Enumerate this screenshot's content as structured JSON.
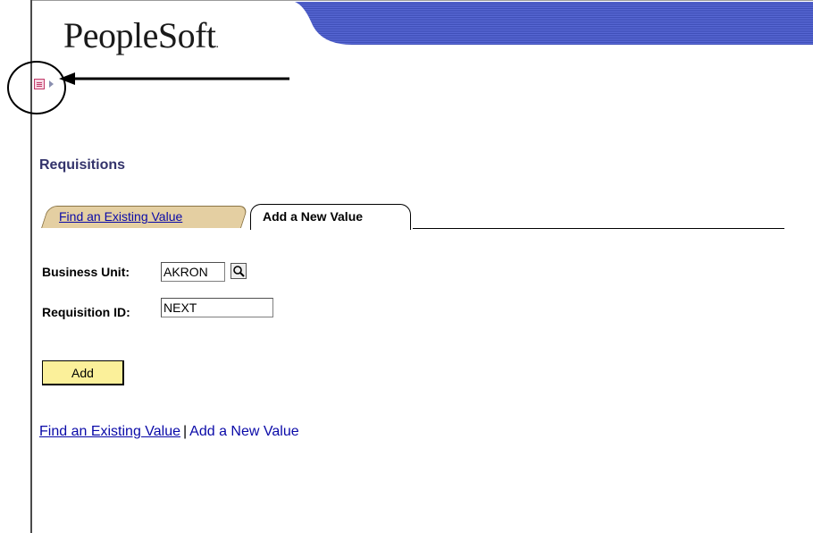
{
  "header": {
    "logo_text": "PeopleSoft",
    "logo_mark": "."
  },
  "page": {
    "title": "Requisitions"
  },
  "tabs": [
    {
      "label": "Find an Existing Value",
      "active": false
    },
    {
      "label": "Add a New Value",
      "active": true
    }
  ],
  "form": {
    "business_unit": {
      "label": "Business Unit:",
      "value": "AKRON"
    },
    "requisition_id": {
      "label": "Requisition ID:",
      "value": "NEXT"
    },
    "add_label": "Add"
  },
  "bottom_links": {
    "find_label": "Find an Existing Value",
    "separator": "|",
    "add_label": "Add a New Value"
  },
  "icons": {
    "menu": "menu-icon",
    "lookup": "search-icon",
    "pointer": "annotation-arrow",
    "highlight": "annotation-circle"
  },
  "colors": {
    "title": "#33336b",
    "link": "#0a0aa8",
    "tab_inactive": "#e4cfa2",
    "button": "#fbf09a",
    "banner": "#4a57c8"
  }
}
